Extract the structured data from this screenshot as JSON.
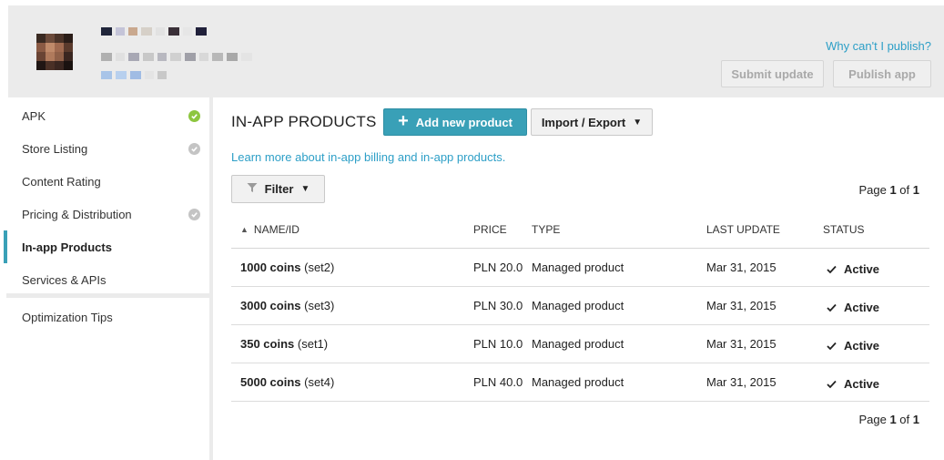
{
  "header": {
    "why_link": "Why can't I publish?",
    "submit_label": "Submit update",
    "publish_label": "Publish app"
  },
  "sidebar": {
    "items": [
      {
        "label": "APK",
        "status": "complete",
        "status_color": "#8dc63f"
      },
      {
        "label": "Store Listing",
        "status": "incomplete",
        "status_color": "#c4c4c4"
      },
      {
        "label": "Content Rating",
        "status": "none"
      },
      {
        "label": "Pricing & Distribution",
        "status": "incomplete",
        "status_color": "#c4c4c4"
      },
      {
        "label": "In-app Products",
        "status": "active"
      },
      {
        "label": "Services & APIs",
        "status": "none"
      },
      {
        "label": "Optimization Tips",
        "status": "none"
      }
    ]
  },
  "main": {
    "title": "IN-APP PRODUCTS",
    "add_button": "Add new product",
    "import_button": "Import / Export",
    "learn_link": "Learn more about in-app billing and in-app products.",
    "filter_button": "Filter",
    "pager": {
      "prefix": "Page",
      "current": "1",
      "sep": "of",
      "total": "1"
    },
    "columns": {
      "name": "NAME/ID",
      "price": "PRICE",
      "type": "TYPE",
      "update": "LAST UPDATE",
      "status": "STATUS"
    },
    "rows": [
      {
        "name": "1000 coins",
        "id": "(set2)",
        "price": "PLN 20.0",
        "type": "Managed product",
        "update": "Mar 31, 2015",
        "status": "Active"
      },
      {
        "name": "3000 coins",
        "id": "(set3)",
        "price": "PLN 30.0",
        "type": "Managed product",
        "update": "Mar 31, 2015",
        "status": "Active"
      },
      {
        "name": "350 coins",
        "id": "(set1)",
        "price": "PLN 10.0",
        "type": "Managed product",
        "update": "Mar 31, 2015",
        "status": "Active"
      },
      {
        "name": "5000 coins",
        "id": "(set4)",
        "price": "PLN 40.0",
        "type": "Managed product",
        "update": "Mar 31, 2015",
        "status": "Active"
      }
    ]
  },
  "colors": {
    "accent": "#39a0b7",
    "link": "#2d9fc7",
    "header_bg": "#ebebeb"
  }
}
